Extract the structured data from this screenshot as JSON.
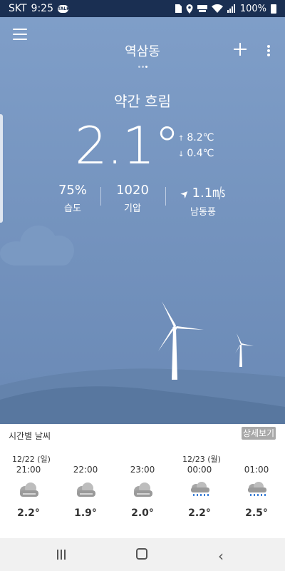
{
  "status_bar": {
    "carrier": "SKT",
    "time": "9:25",
    "chat_icon_text": "TALK",
    "battery": "100%",
    "icons": [
      "sim-card-icon",
      "location-icon",
      "volte-icon",
      "wifi-icon",
      "signal-icon",
      "battery-icon"
    ]
  },
  "header": {
    "location": "역삼동",
    "menu_icon": "hamburger-icon",
    "add_icon": "plus-icon",
    "more_icon": "kebab-icon"
  },
  "current": {
    "condition": "약간 흐림",
    "temperature": "2.1°",
    "high": "8.2℃",
    "low": "0.4℃",
    "high_arrow": "↑",
    "low_arrow": "↓",
    "humidity_value": "75%",
    "humidity_label": "습도",
    "pressure_value": "1020",
    "pressure_label": "기압",
    "wind_arrow": "➤",
    "wind_value": "1.1㎧",
    "wind_label": "남동풍"
  },
  "hourly": {
    "title": "시간별 날씨",
    "detail_button": "상세보기",
    "days": [
      {
        "label": "12/22 (일)"
      },
      {
        "label": "12/23 (월)"
      }
    ],
    "items": [
      {
        "time": "21:00",
        "icon": "cloudy-icon",
        "temp": "2.2°"
      },
      {
        "time": "22:00",
        "icon": "cloudy-icon",
        "temp": "1.9°"
      },
      {
        "time": "23:00",
        "icon": "cloudy-icon",
        "temp": "2.0°"
      },
      {
        "time": "00:00",
        "icon": "rain-cloud-icon",
        "temp": "2.2°"
      },
      {
        "time": "01:00",
        "icon": "rain-cloud-icon",
        "temp": "2.5°"
      }
    ]
  },
  "colors": {
    "sky_top": "#7f9ec8",
    "sky_bottom": "#6a89b5",
    "status_bar": "#1a2f52",
    "hill_front": "#58779f",
    "hill_back": "#6483ac",
    "detail_button": "#a9a9a9"
  }
}
